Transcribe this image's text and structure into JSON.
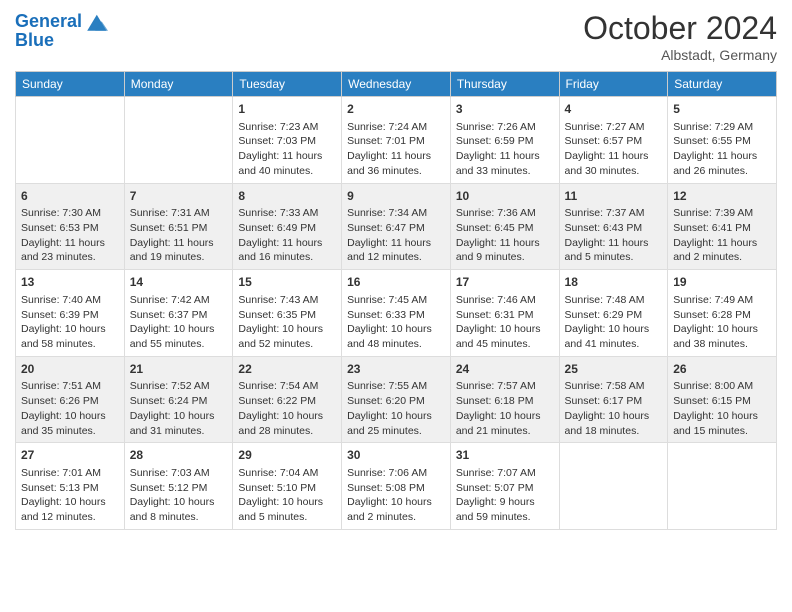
{
  "header": {
    "logo_line1": "General",
    "logo_line2": "Blue",
    "month": "October 2024",
    "location": "Albstadt, Germany"
  },
  "days_of_week": [
    "Sunday",
    "Monday",
    "Tuesday",
    "Wednesday",
    "Thursday",
    "Friday",
    "Saturday"
  ],
  "weeks": [
    [
      {
        "day": "",
        "sunrise": "",
        "sunset": "",
        "daylight": ""
      },
      {
        "day": "",
        "sunrise": "",
        "sunset": "",
        "daylight": ""
      },
      {
        "day": "1",
        "sunrise": "Sunrise: 7:23 AM",
        "sunset": "Sunset: 7:03 PM",
        "daylight": "Daylight: 11 hours and 40 minutes."
      },
      {
        "day": "2",
        "sunrise": "Sunrise: 7:24 AM",
        "sunset": "Sunset: 7:01 PM",
        "daylight": "Daylight: 11 hours and 36 minutes."
      },
      {
        "day": "3",
        "sunrise": "Sunrise: 7:26 AM",
        "sunset": "Sunset: 6:59 PM",
        "daylight": "Daylight: 11 hours and 33 minutes."
      },
      {
        "day": "4",
        "sunrise": "Sunrise: 7:27 AM",
        "sunset": "Sunset: 6:57 PM",
        "daylight": "Daylight: 11 hours and 30 minutes."
      },
      {
        "day": "5",
        "sunrise": "Sunrise: 7:29 AM",
        "sunset": "Sunset: 6:55 PM",
        "daylight": "Daylight: 11 hours and 26 minutes."
      }
    ],
    [
      {
        "day": "6",
        "sunrise": "Sunrise: 7:30 AM",
        "sunset": "Sunset: 6:53 PM",
        "daylight": "Daylight: 11 hours and 23 minutes."
      },
      {
        "day": "7",
        "sunrise": "Sunrise: 7:31 AM",
        "sunset": "Sunset: 6:51 PM",
        "daylight": "Daylight: 11 hours and 19 minutes."
      },
      {
        "day": "8",
        "sunrise": "Sunrise: 7:33 AM",
        "sunset": "Sunset: 6:49 PM",
        "daylight": "Daylight: 11 hours and 16 minutes."
      },
      {
        "day": "9",
        "sunrise": "Sunrise: 7:34 AM",
        "sunset": "Sunset: 6:47 PM",
        "daylight": "Daylight: 11 hours and 12 minutes."
      },
      {
        "day": "10",
        "sunrise": "Sunrise: 7:36 AM",
        "sunset": "Sunset: 6:45 PM",
        "daylight": "Daylight: 11 hours and 9 minutes."
      },
      {
        "day": "11",
        "sunrise": "Sunrise: 7:37 AM",
        "sunset": "Sunset: 6:43 PM",
        "daylight": "Daylight: 11 hours and 5 minutes."
      },
      {
        "day": "12",
        "sunrise": "Sunrise: 7:39 AM",
        "sunset": "Sunset: 6:41 PM",
        "daylight": "Daylight: 11 hours and 2 minutes."
      }
    ],
    [
      {
        "day": "13",
        "sunrise": "Sunrise: 7:40 AM",
        "sunset": "Sunset: 6:39 PM",
        "daylight": "Daylight: 10 hours and 58 minutes."
      },
      {
        "day": "14",
        "sunrise": "Sunrise: 7:42 AM",
        "sunset": "Sunset: 6:37 PM",
        "daylight": "Daylight: 10 hours and 55 minutes."
      },
      {
        "day": "15",
        "sunrise": "Sunrise: 7:43 AM",
        "sunset": "Sunset: 6:35 PM",
        "daylight": "Daylight: 10 hours and 52 minutes."
      },
      {
        "day": "16",
        "sunrise": "Sunrise: 7:45 AM",
        "sunset": "Sunset: 6:33 PM",
        "daylight": "Daylight: 10 hours and 48 minutes."
      },
      {
        "day": "17",
        "sunrise": "Sunrise: 7:46 AM",
        "sunset": "Sunset: 6:31 PM",
        "daylight": "Daylight: 10 hours and 45 minutes."
      },
      {
        "day": "18",
        "sunrise": "Sunrise: 7:48 AM",
        "sunset": "Sunset: 6:29 PM",
        "daylight": "Daylight: 10 hours and 41 minutes."
      },
      {
        "day": "19",
        "sunrise": "Sunrise: 7:49 AM",
        "sunset": "Sunset: 6:28 PM",
        "daylight": "Daylight: 10 hours and 38 minutes."
      }
    ],
    [
      {
        "day": "20",
        "sunrise": "Sunrise: 7:51 AM",
        "sunset": "Sunset: 6:26 PM",
        "daylight": "Daylight: 10 hours and 35 minutes."
      },
      {
        "day": "21",
        "sunrise": "Sunrise: 7:52 AM",
        "sunset": "Sunset: 6:24 PM",
        "daylight": "Daylight: 10 hours and 31 minutes."
      },
      {
        "day": "22",
        "sunrise": "Sunrise: 7:54 AM",
        "sunset": "Sunset: 6:22 PM",
        "daylight": "Daylight: 10 hours and 28 minutes."
      },
      {
        "day": "23",
        "sunrise": "Sunrise: 7:55 AM",
        "sunset": "Sunset: 6:20 PM",
        "daylight": "Daylight: 10 hours and 25 minutes."
      },
      {
        "day": "24",
        "sunrise": "Sunrise: 7:57 AM",
        "sunset": "Sunset: 6:18 PM",
        "daylight": "Daylight: 10 hours and 21 minutes."
      },
      {
        "day": "25",
        "sunrise": "Sunrise: 7:58 AM",
        "sunset": "Sunset: 6:17 PM",
        "daylight": "Daylight: 10 hours and 18 minutes."
      },
      {
        "day": "26",
        "sunrise": "Sunrise: 8:00 AM",
        "sunset": "Sunset: 6:15 PM",
        "daylight": "Daylight: 10 hours and 15 minutes."
      }
    ],
    [
      {
        "day": "27",
        "sunrise": "Sunrise: 7:01 AM",
        "sunset": "Sunset: 5:13 PM",
        "daylight": "Daylight: 10 hours and 12 minutes."
      },
      {
        "day": "28",
        "sunrise": "Sunrise: 7:03 AM",
        "sunset": "Sunset: 5:12 PM",
        "daylight": "Daylight: 10 hours and 8 minutes."
      },
      {
        "day": "29",
        "sunrise": "Sunrise: 7:04 AM",
        "sunset": "Sunset: 5:10 PM",
        "daylight": "Daylight: 10 hours and 5 minutes."
      },
      {
        "day": "30",
        "sunrise": "Sunrise: 7:06 AM",
        "sunset": "Sunset: 5:08 PM",
        "daylight": "Daylight: 10 hours and 2 minutes."
      },
      {
        "day": "31",
        "sunrise": "Sunrise: 7:07 AM",
        "sunset": "Sunset: 5:07 PM",
        "daylight": "Daylight: 9 hours and 59 minutes."
      },
      {
        "day": "",
        "sunrise": "",
        "sunset": "",
        "daylight": ""
      },
      {
        "day": "",
        "sunrise": "",
        "sunset": "",
        "daylight": ""
      }
    ]
  ]
}
